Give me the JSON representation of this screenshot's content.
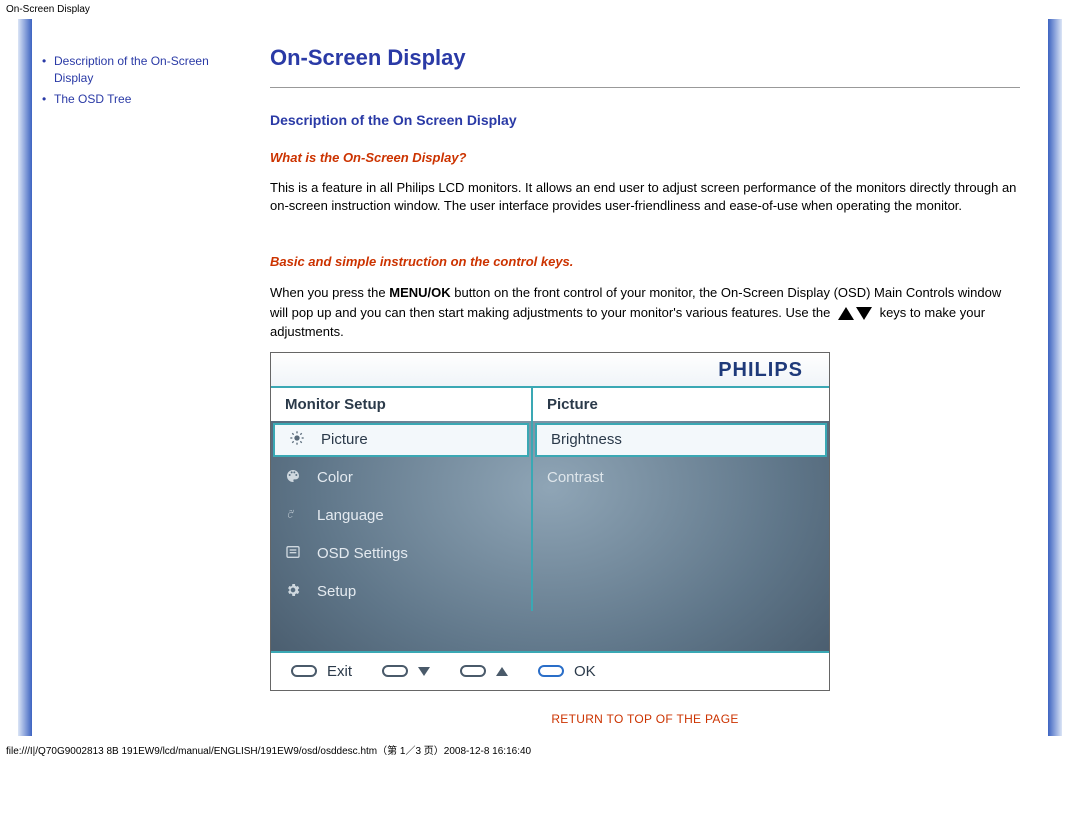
{
  "header_small": "On-Screen Display",
  "sidebar": {
    "items": [
      {
        "label": "Description of the On-Screen Display"
      },
      {
        "label": "The OSD Tree"
      }
    ]
  },
  "main": {
    "title": "On-Screen Display",
    "section_heading": "Description of the On Screen Display",
    "sub1": "What is the On-Screen Display?",
    "para1": "This is a feature in all Philips LCD monitors. It allows an end user to adjust screen performance of the monitors directly through an on-screen instruction window. The user interface provides user-friendliness and ease-of-use when operating the monitor.",
    "sub2": "Basic and simple instruction on the control keys.",
    "para2_a": "When you press the ",
    "para2_b": "MENU/OK",
    "para2_c": " button on the front control of your monitor, the On-Screen Display (OSD) Main Controls window will pop up and you can then start making adjustments to your monitor's various features. Use the ",
    "para2_d": " keys to make your adjustments."
  },
  "osd": {
    "brand": "PHILIPS",
    "header_left": "Monitor Setup",
    "header_right": "Picture",
    "left_items": [
      {
        "label": "Picture",
        "selected": true,
        "icon": "brightness-icon"
      },
      {
        "label": "Color",
        "selected": false,
        "icon": "palette-icon"
      },
      {
        "label": "Language",
        "selected": false,
        "icon": "language-icon"
      },
      {
        "label": "OSD Settings",
        "selected": false,
        "icon": "list-icon"
      },
      {
        "label": "Setup",
        "selected": false,
        "icon": "gear-icon"
      }
    ],
    "right_items": [
      {
        "label": "Brightness",
        "selected": true
      },
      {
        "label": "Contrast",
        "selected": false
      }
    ],
    "footer": {
      "exit": "Exit",
      "ok": "OK"
    }
  },
  "return_link": "RETURN TO TOP OF THE PAGE",
  "footer_path": "file:///I|/Q70G9002813 8B 191EW9/lcd/manual/ENGLISH/191EW9/osd/osddesc.htm（第 1／3 页）2008-12-8 16:16:40"
}
